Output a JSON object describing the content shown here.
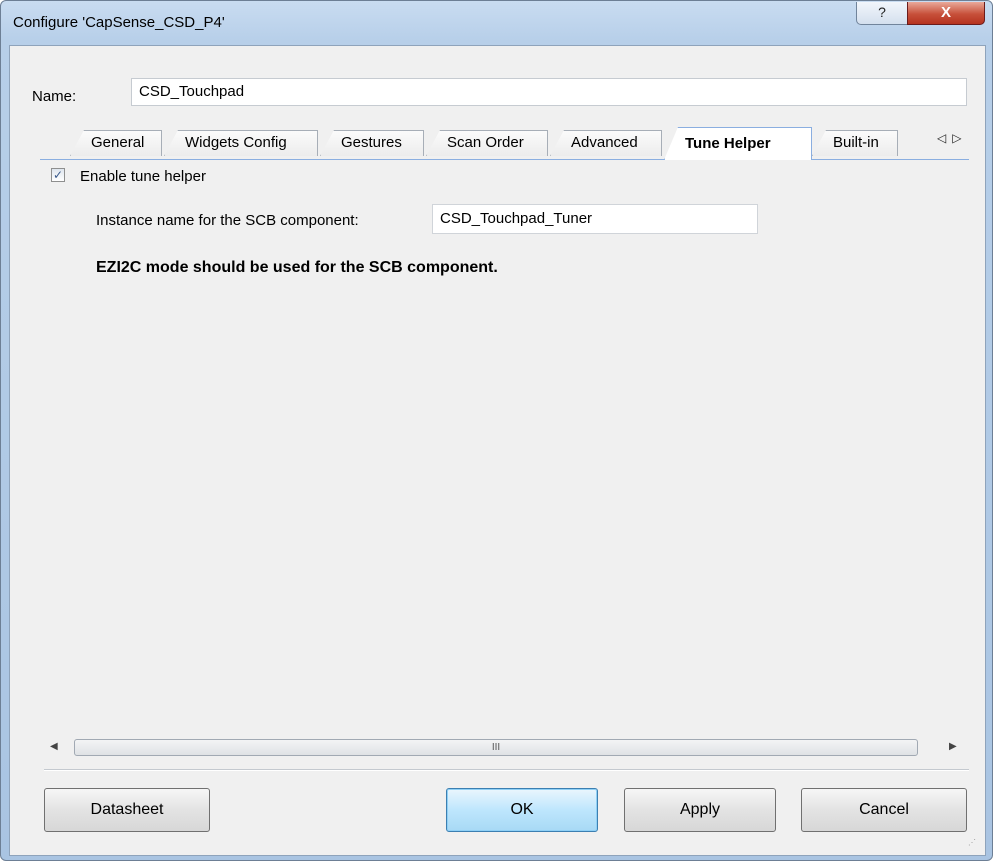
{
  "window": {
    "title": "Configure 'CapSense_CSD_P4'",
    "help_glyph": "?",
    "close_glyph": "X"
  },
  "name_row": {
    "label": "Name:",
    "value": "CSD_Touchpad"
  },
  "tabs": [
    {
      "label": "General",
      "active": false
    },
    {
      "label": "Widgets Config",
      "active": false
    },
    {
      "label": "Gestures",
      "active": false
    },
    {
      "label": "Scan Order",
      "active": false
    },
    {
      "label": "Advanced",
      "active": false
    },
    {
      "label": "Tune Helper",
      "active": true
    },
    {
      "label": "Built-in",
      "active": false
    }
  ],
  "tab_scroll": {
    "left_glyph": "◁",
    "right_glyph": "▷"
  },
  "tune_helper": {
    "enable_checked": true,
    "enable_label": "Enable tune helper",
    "instance_label": "Instance name for the SCB component:",
    "instance_value": "CSD_Touchpad_Tuner",
    "note": "EZI2C mode should be used for the SCB component."
  },
  "scrollbar": {
    "left_glyph": "◀",
    "right_glyph": "▶",
    "thumb_glyph": "III"
  },
  "buttons": {
    "datasheet": "Datasheet",
    "ok": "OK",
    "apply": "Apply",
    "cancel": "Cancel"
  }
}
